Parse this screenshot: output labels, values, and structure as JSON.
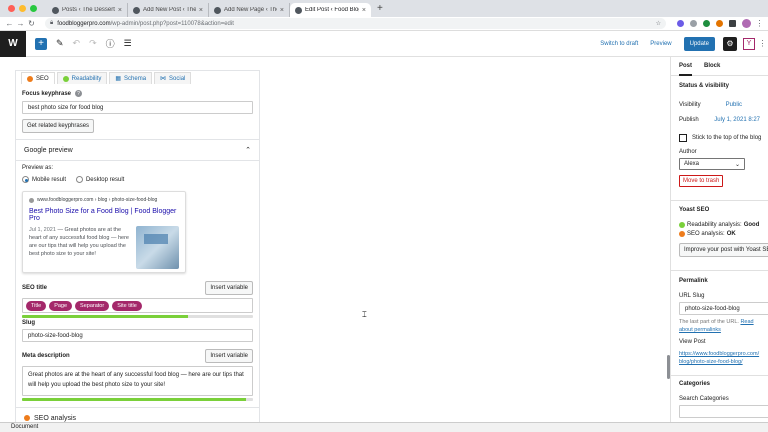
{
  "browser": {
    "tabs": [
      {
        "title": "Posts ‹ The Dessert Food Blog"
      },
      {
        "title": "Add New Post ‹ The Dessert F"
      },
      {
        "title": "Add New Page ‹ The Dessert"
      },
      {
        "title": "Edit Post ‹ Food Blogger Pro —"
      }
    ],
    "new_tab": "+",
    "url_host": "foodbloggerpro.com",
    "url_path": "/wp-admin/post.php?post=110078&action=edit"
  },
  "wp_toolbar": {
    "logo": "W",
    "add": "+",
    "switch_to_draft": "Switch to draft",
    "preview": "Preview",
    "update": "Update",
    "yoast": "Y"
  },
  "yoast": {
    "tabs": [
      "SEO",
      "Readability",
      "Schema",
      "Social"
    ],
    "focus_keyphrase_label": "Focus keyphrase",
    "help": "?",
    "focus_keyphrase_value": "best photo size for food blog",
    "get_related": "Get related keyphrases",
    "google_preview": "Google preview",
    "preview_as": "Preview as:",
    "mobile_result": "Mobile result",
    "desktop_result": "Desktop result",
    "snippet": {
      "url": "www.foodbloggerpro.com › blog › photo-size-food-blog",
      "title": "Best Photo Size for a Food Blog | Food Blogger Pro",
      "date": "Jul 1, 2021",
      "description": "Great photos are at the heart of any successful food blog — here are our tips that will help you upload the best photo size to your site!"
    },
    "seo_title_label": "SEO title",
    "insert_variable": "Insert variable",
    "variables": [
      "Title",
      "Page",
      "Separator",
      "Site title"
    ],
    "seo_title_progress": 0.72,
    "slug_label": "Slug",
    "slug_value": "photo-size-food-blog",
    "meta_description_label": "Meta description",
    "meta_description_value": "Great photos are at the heart of any successful food blog — here are our tips that will help you upload the best photo size to your site!",
    "meta_progress": 0.97,
    "seo_analysis": "SEO analysis"
  },
  "sidebar": {
    "tab_post": "Post",
    "tab_block": "Block",
    "status_visibility": "Status & visibility",
    "visibility_label": "Visibility",
    "visibility_value": "Public",
    "publish_label": "Publish",
    "publish_value": "July 1, 2021 8:27",
    "stick_to_top": "Stick to the top of the blog",
    "author_label": "Author",
    "author_value": "Alexa",
    "move_to_trash": "Move to trash",
    "yoast_seo": "Yoast SEO",
    "readability_analysis": "Readability analysis:",
    "readability_value": "Good",
    "seo_analysis": "SEO analysis:",
    "seo_value": "OK",
    "improve_post": "Improve your post with Yoast SEO",
    "permalink": "Permalink",
    "url_slug_label": "URL Slug",
    "url_slug_value": "photo-size-food-blog",
    "last_part": "The last part of the URL.",
    "read_about": "Read about permalinks",
    "view_post": "View Post",
    "view_post_url": "https://www.foodbloggerpro.com/blog/photo-size-food-blog/",
    "categories": "Categories",
    "search_categories": "Search Categories"
  },
  "statusbar": {
    "label": "Document"
  },
  "colors": {
    "good": "#7ad03a",
    "ok": "#ee7c1b",
    "accent": "#2271b1",
    "yoast": "#a4286a"
  }
}
